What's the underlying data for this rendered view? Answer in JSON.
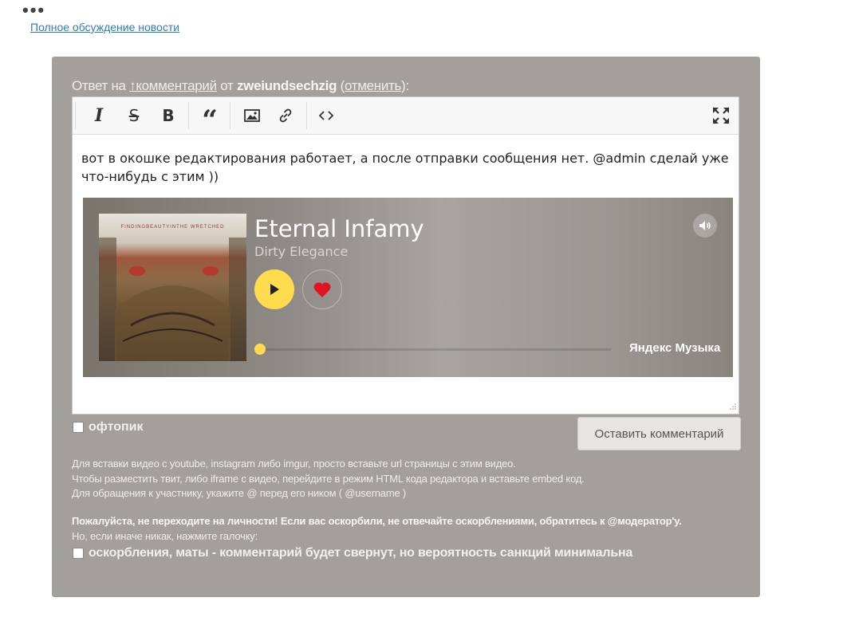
{
  "top": {
    "dots": "•••",
    "link": "Полное обсуждение новости"
  },
  "reply": {
    "prefix": "Ответ на ",
    "comment_link": "↑комментарий",
    "from": " от ",
    "username": "zweiundsechzig",
    "open_paren": " (",
    "cancel": "отменить",
    "close_paren": "):"
  },
  "toolbar": {
    "icons": [
      "italic-icon",
      "strikethrough-icon",
      "bold-icon",
      "quote-icon",
      "image-icon",
      "link-icon",
      "code-icon",
      "fullscreen-icon"
    ]
  },
  "editor": {
    "text": "вот в окошке редактирования работает, а после отправки сообщения нет. @admin сделай уже что-нибудь с этим ))"
  },
  "player": {
    "cover_text": "FINDINGBEAUTYINTHE WRETCHED",
    "title": "Eternal Infamy",
    "artist": "Dirty Elegance",
    "service": "Яндекс Музыка",
    "progress": 0,
    "accent": "#ffdb4d",
    "like_color": "#e0141e"
  },
  "form": {
    "offtopic_label": "офтопик",
    "submit_label": "Оставить комментарий",
    "hint1": "Для вставки видео с youtube, instagram либо imgur, просто вставьте url страницы с этим видео.",
    "hint2": "Чтобы разместить твит, либо iframe с видео, перейдите в режим HTML кода редактора и вставьте embed код.",
    "hint3": "Для обращения к участнику, укажите @ перед его ником ( @username )",
    "warn_bold": "Пожалуйста, не переходите на личности! Если вас оскорбили, не отвечайте оскорблениями, обратитесь к @модератор'у.",
    "warn_normal": "Но, если иначе никак, нажмите галочку:",
    "insult_label": "оскорбления, маты - комментарий будет свернут, но вероятность санкций минимальна"
  },
  "colors": {
    "panel_bg": "#a29f9c",
    "link": "#2f7fb8"
  }
}
